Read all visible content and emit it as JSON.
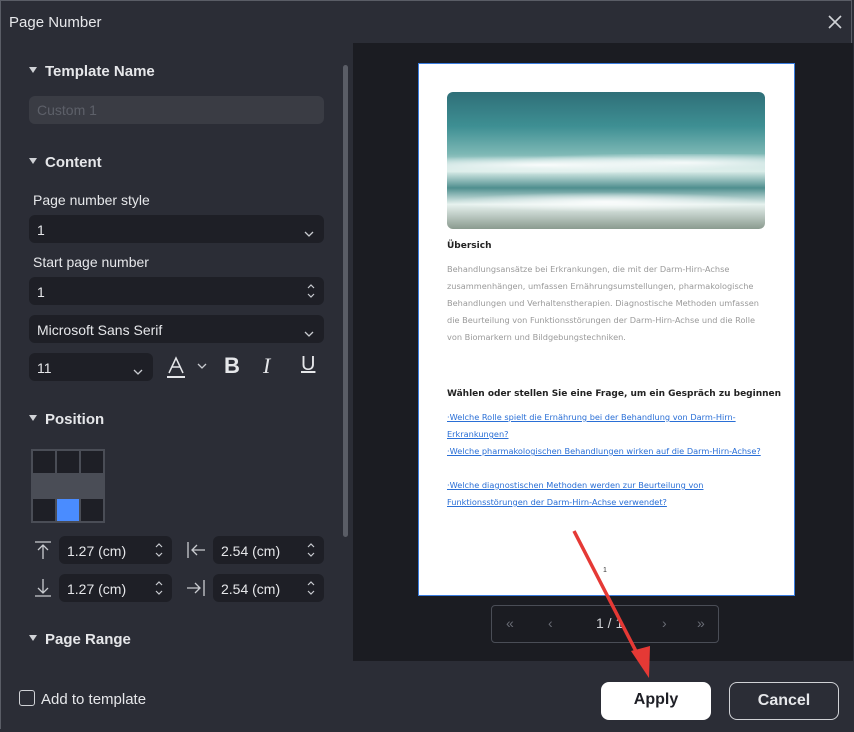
{
  "window": {
    "title": "Page Number"
  },
  "sections": {
    "template_name": "Template Name",
    "content": "Content",
    "position": "Position",
    "page_range": "Page Range"
  },
  "template_name": {
    "placeholder": "Custom 1"
  },
  "content": {
    "page_number_style_label": "Page number style",
    "page_number_style_value": "1",
    "start_page_number_label": "Start page number",
    "start_page_number_value": "1",
    "font_value": "Microsoft Sans Serif",
    "font_size_value": "11",
    "bold_glyph": "B",
    "italic_glyph": "I",
    "underline_glyph": "U"
  },
  "position": {
    "selected_cell": "bottom-center",
    "top_margin": "1.27 (cm)",
    "left_margin": "2.54 (cm)",
    "bottom_margin": "1.27 (cm)",
    "right_margin": "2.54 (cm)"
  },
  "preview": {
    "heading": "Übersich",
    "body": "Behandlungsansätze bei Erkrankungen, die mit der Darm-Hirn-Achse zusammenhängen, umfassen Ernährungsumstellungen, pharmakologische Behandlungen und Verhaltenstherapien. Diagnostische Methoden umfassen die Beurteilung von Funktionsstörungen der Darm-Hirn-Achse und die Rolle von Biomarkern und Bildgebungstechniken.",
    "question_heading": "Wählen oder stellen Sie eine Frage, um ein Gespräch zu beginnen",
    "links": [
      "·Welche Rolle spielt die Ernährung bei der Behandlung von Darm-Hirn-Erkrankungen?",
      "·Welche pharmakologischen Behandlungen wirken auf die Darm-Hirn-Achse?",
      "·Welche diagnostischen Methoden werden zur Beurteilung von Funktionsstörungen der Darm-Hirn-Achse verwendet?"
    ],
    "page_number": "1",
    "pager": "1 / 1"
  },
  "footer": {
    "add_to_template": "Add to template",
    "apply": "Apply",
    "cancel": "Cancel"
  },
  "colors": {
    "accent": "#4a8cff",
    "annotation_arrow": "#e53935"
  }
}
